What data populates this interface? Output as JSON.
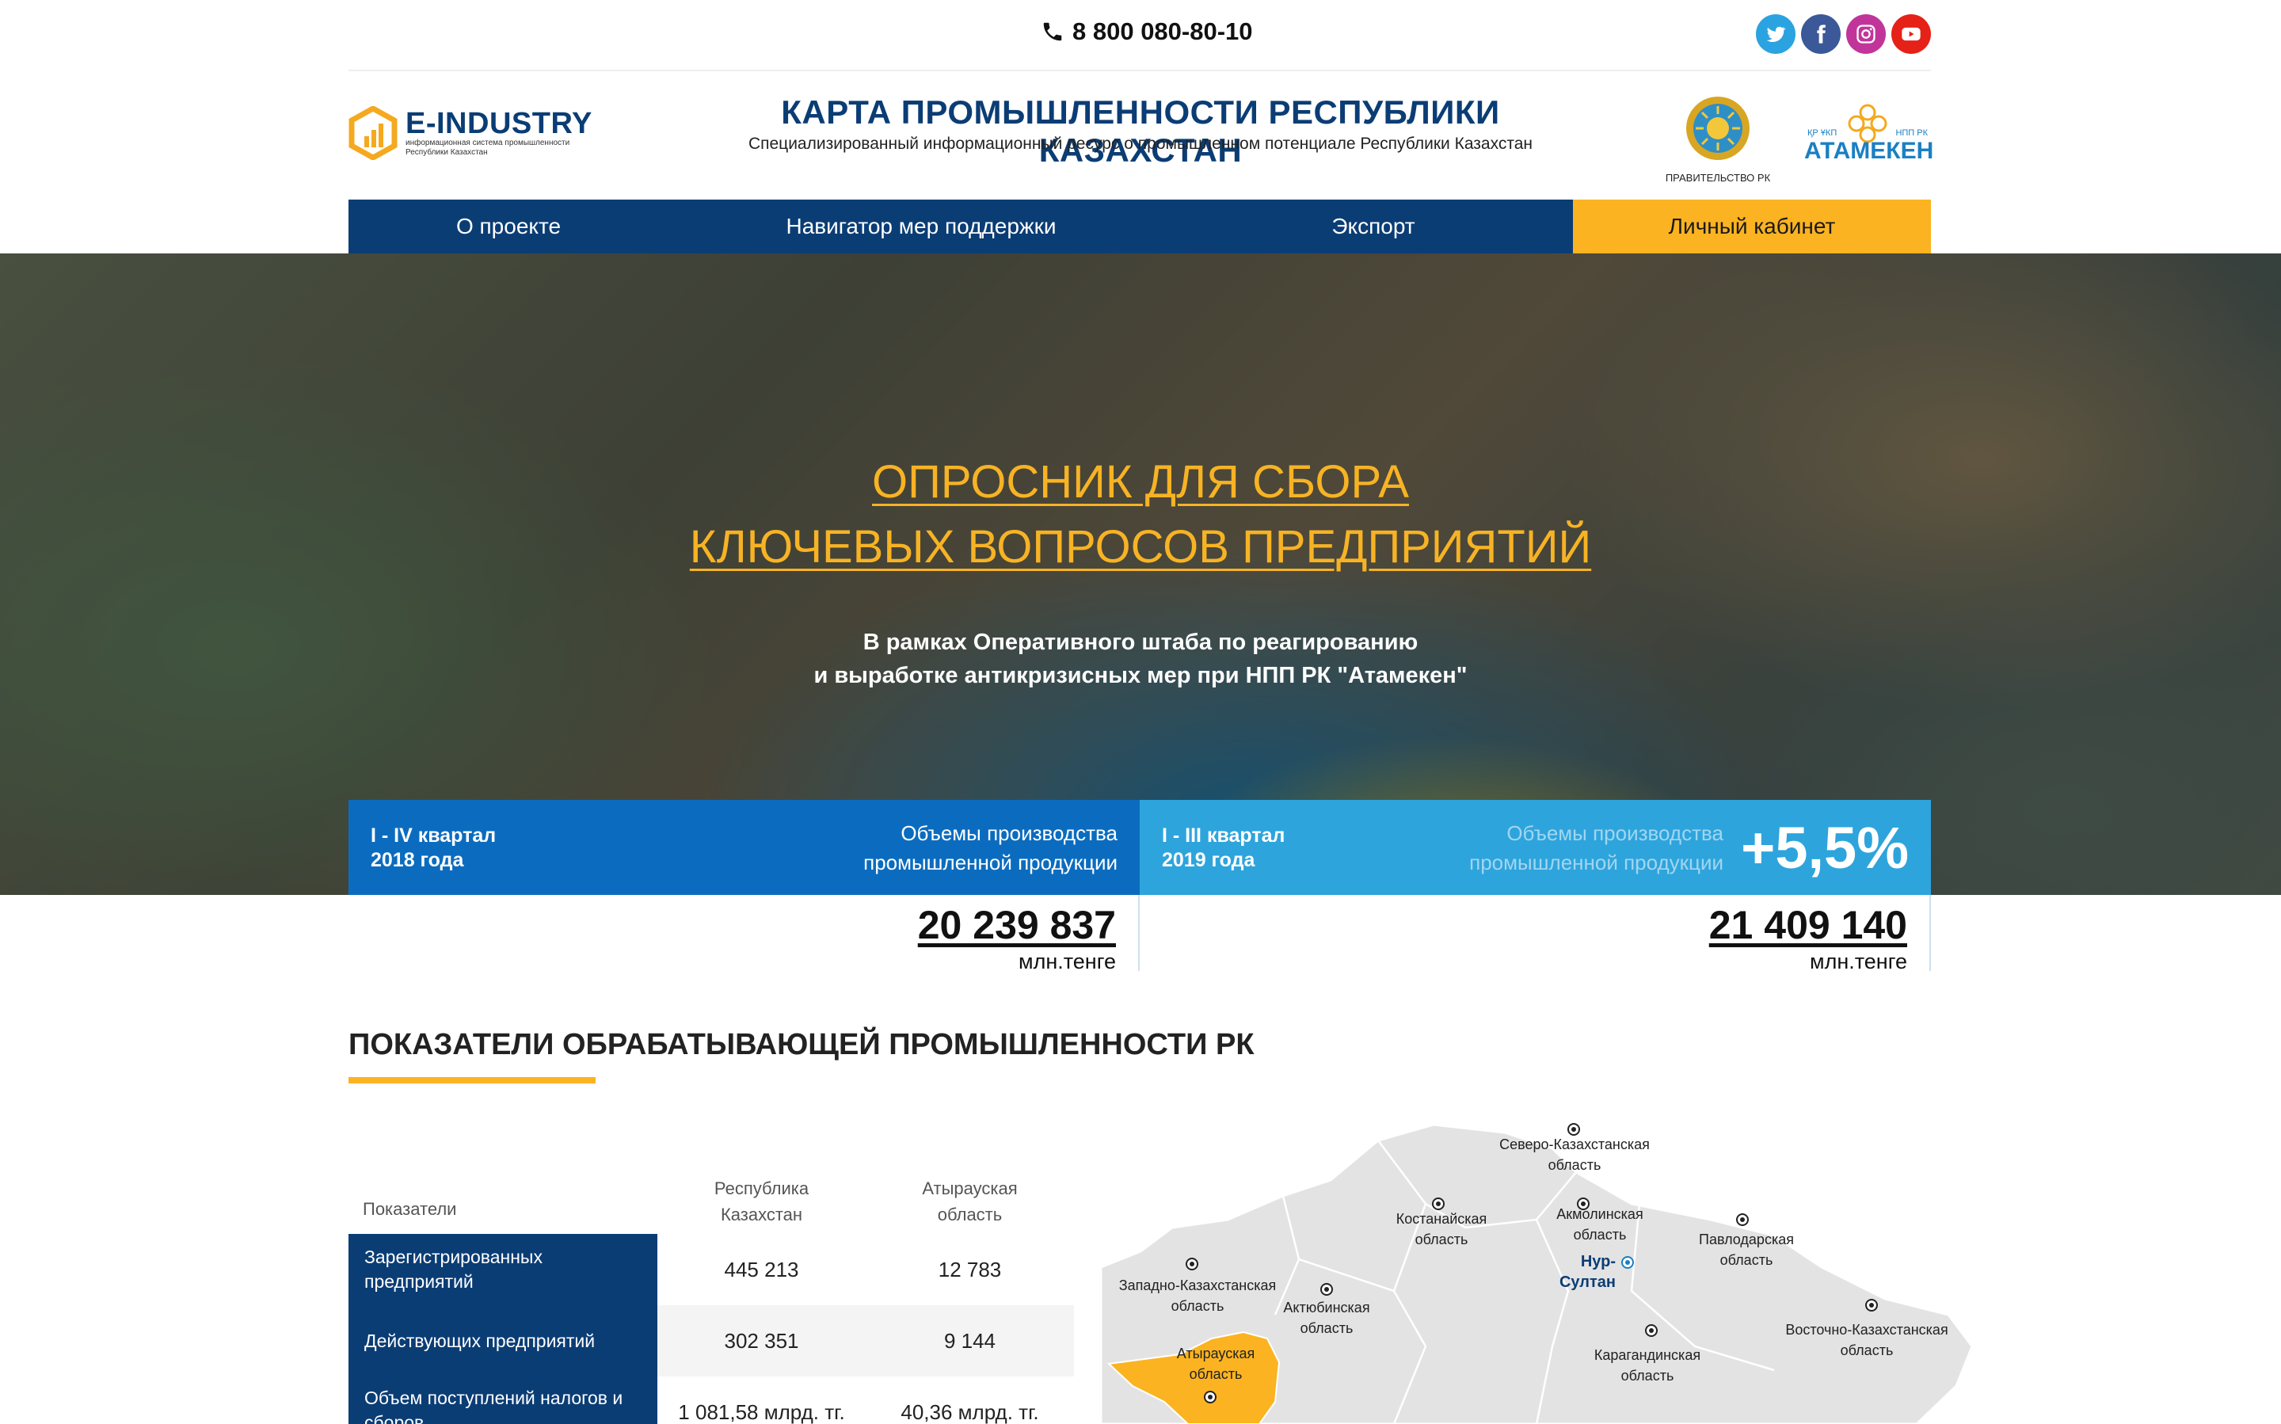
{
  "topbar": {
    "phone": "8 800 080-80-10",
    "socials": [
      {
        "name": "twitter-icon",
        "color": "#2aa3e0"
      },
      {
        "name": "facebook-icon",
        "color": "#3b5998"
      },
      {
        "name": "instagram-icon",
        "color": "#c1359b"
      },
      {
        "name": "youtube-icon",
        "color": "#e62117"
      }
    ]
  },
  "header": {
    "logo_title": "E-INDUSTRY",
    "logo_sub": "информационная система промышленности Республики Казахстан",
    "title": "КАРТА ПРОМЫШЛЕННОСТИ РЕСПУБЛИКИ КАЗАХСТАН",
    "subtitle": "Специализированный информационный ресурс о промышленном потенциале Республики Казахстан",
    "gov_label": "ПРАВИТЕЛЬСТВО РК",
    "atameken_left": "ҚР ҰКП",
    "atameken_right": "НПП РК",
    "atameken_name": "АТАМЕКЕН"
  },
  "nav": {
    "items": [
      {
        "label": "О проекте"
      },
      {
        "label": "Навигатор мер поддержки"
      },
      {
        "label": "Экспорт"
      },
      {
        "label": "Личный кабинет",
        "active": true
      }
    ]
  },
  "hero": {
    "title_line1": "ОПРОСНИК ДЛЯ СБОРА",
    "title_line2": "КЛЮЧЕВЫХ ВОПРОСОВ ПРЕДПРИЯТИЙ",
    "sub_line1": "В рамках Оперативного штаба по реагированию",
    "sub_line2": "и выработке антикризисных мер при НПП РК \"Атамекен\""
  },
  "stats": [
    {
      "period_line1": "I - IV квартал",
      "period_line2": "2018 года",
      "desc_line1": "Объемы производства",
      "desc_line2": "промышленной продукции",
      "value": "20 239 837",
      "unit": "млн.тенге"
    },
    {
      "period_line1": "I - III квартал",
      "period_line2": "2019 года",
      "desc_line1": "Объемы производства",
      "desc_line2": "промышленной продукции",
      "growth": "+5,5%",
      "value": "21 409 140",
      "unit": "млн.тенге"
    }
  ],
  "section": {
    "title": "ПОКАЗАТЕЛИ ОБРАБАТЫВАЮЩЕЙ ПРОМЫШЛЕННОСТИ РК",
    "accent": "#fbb321"
  },
  "table": {
    "headers": {
      "indicators": "Показатели",
      "col1_line1": "Республика",
      "col1_line2": "Казахстан",
      "col2_line1": "Атырауская",
      "col2_line2": "область"
    },
    "rows": [
      {
        "label": "Зарегистрированных предприятий",
        "v1": "445 213",
        "v2": "12 783"
      },
      {
        "label": "Действующих предприятий",
        "v1": "302 351",
        "v2": "9 144"
      },
      {
        "label": "Объем поступлений налогов и сборов",
        "v1": "1 081,58 млрд. тг.",
        "v2": "40,36 млрд. тг."
      }
    ]
  },
  "map": {
    "highlight_color": "#fbb321",
    "regions": [
      {
        "l1": "Северо-Казахстанская",
        "l2": "область"
      },
      {
        "l1": "Костанайская",
        "l2": "область"
      },
      {
        "l1": "Акмолинская",
        "l2": "область"
      },
      {
        "l1": "Павлодарская",
        "l2": "область"
      },
      {
        "l1": "Западно-Казахстанская",
        "l2": "область"
      },
      {
        "l1": "Актюбинская",
        "l2": "область"
      },
      {
        "l1": "Атырауская",
        "l2": "область"
      },
      {
        "l1": "Карагандинская",
        "l2": "область"
      },
      {
        "l1": "Восточно-Казахстанская",
        "l2": "область"
      }
    ],
    "capital": "Нур-Султан"
  }
}
